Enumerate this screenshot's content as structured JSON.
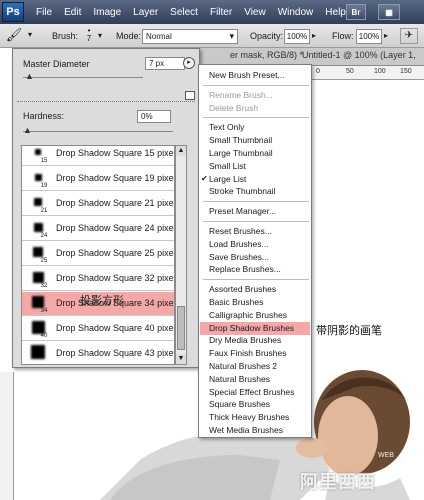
{
  "menubar": {
    "logo": "Ps",
    "items": [
      "File",
      "Edit",
      "Image",
      "Layer",
      "Select",
      "Filter",
      "View",
      "Window",
      "Help"
    ],
    "bridge_button": "Br",
    "minibridge_button": "▦"
  },
  "options_bar": {
    "brush_label": "Brush:",
    "brush_size": "7",
    "mode_label": "Mode:",
    "mode_value": "Normal",
    "opacity_label": "Opacity:",
    "opacity_value": "100%",
    "flow_label": "Flow:",
    "flow_value": "100%"
  },
  "document": {
    "tab_1": "er mask, RGB/8) *",
    "tab_2": "Untitled-1 @ 100% (Layer 1,",
    "ruler_marks": [
      "0",
      "50",
      "100",
      "150",
      "200"
    ]
  },
  "brush_panel": {
    "master_diameter_label": "Master Diameter",
    "master_diameter_value": "7 px",
    "hardness_label": "Hardness:",
    "hardness_value": "0%",
    "brushes": [
      {
        "size": "15",
        "name": "Drop Shadow Square 15 pixels"
      },
      {
        "size": "19",
        "name": "Drop Shadow Square 19 pixels"
      },
      {
        "size": "21",
        "name": "Drop Shadow Square 21 pixels"
      },
      {
        "size": "24",
        "name": "Drop Shadow Square 24 pixels"
      },
      {
        "size": "25",
        "name": "Drop Shadow Square 25 pixels"
      },
      {
        "size": "32",
        "name": "Drop Shadow Square 32 pixels"
      },
      {
        "size": "34",
        "name": "Drop Shadow Square 34 pixels"
      },
      {
        "size": "40",
        "name": "Drop Shadow Square 40 pixels"
      },
      {
        "size": "",
        "name": "Drop Shadow Square 43 pixels"
      }
    ],
    "annotation": "投影方形"
  },
  "flyout_menu": {
    "group1": [
      "New Brush Preset..."
    ],
    "group2": [
      "Rename Brush...",
      "Delete Brush"
    ],
    "group3": [
      "Text Only",
      "Small Thumbnail",
      "Large Thumbnail",
      "Small List",
      "Large List",
      "Stroke Thumbnail"
    ],
    "group4": [
      "Preset Manager..."
    ],
    "group5": [
      "Reset Brushes...",
      "Load Brushes...",
      "Save Brushes...",
      "Replace Brushes..."
    ],
    "group6": [
      "Assorted Brushes",
      "Basic Brushes",
      "Calligraphic Brushes",
      "Drop Shadow Brushes",
      "Dry Media Brushes",
      "Faux Finish Brushes",
      "Natural Brushes 2",
      "Natural Brushes",
      "Special Effect Brushes",
      "Square Brushes",
      "Thick Heavy Brushes",
      "Wet Media Brushes"
    ],
    "checked_item": "Large List",
    "highlighted_item": "Drop Shadow Brushes",
    "annotation": "带阴影的画笔"
  },
  "watermark": {
    "text": "阿里西西",
    "small": "WEB"
  }
}
